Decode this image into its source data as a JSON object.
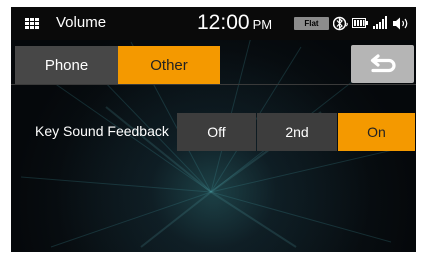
{
  "statusbar": {
    "title": "Volume",
    "time": "12:00",
    "ampm": "PM",
    "eq_badge": "Flat",
    "icons": [
      "grid-menu-icon",
      "bluetooth-audio-icon",
      "battery-icon",
      "signal-strength-icon",
      "speaker-volume-icon"
    ]
  },
  "tabs": [
    {
      "label": "Phone",
      "selected": false
    },
    {
      "label": "Other",
      "selected": true
    }
  ],
  "back": {
    "icon": "return-arrow-icon"
  },
  "setting": {
    "label": "Key Sound Feedback",
    "options": [
      "Off",
      "2nd",
      "On"
    ],
    "selected": "On"
  },
  "colors": {
    "accent": "#f49900",
    "button": "#3d3d3d",
    "tab_inactive": "#474747",
    "back_button": "#b5b5b5",
    "statusbar": "#0a0a0a"
  }
}
